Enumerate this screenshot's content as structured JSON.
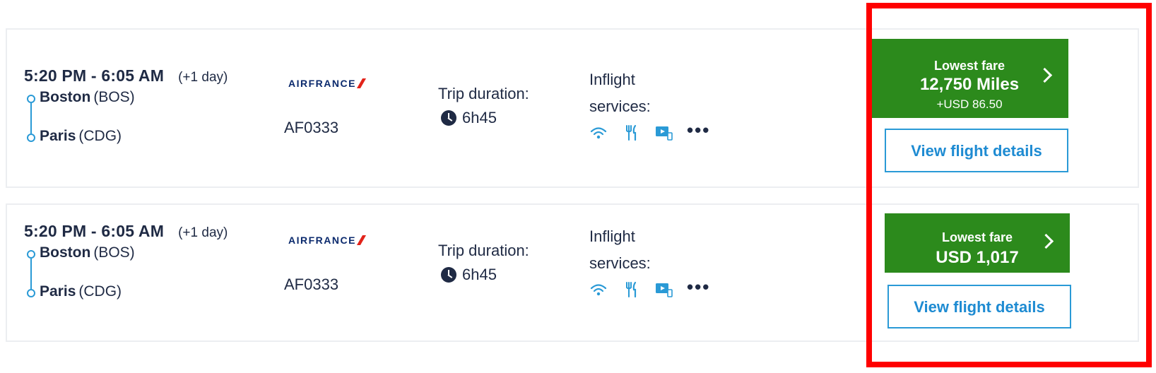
{
  "flights": [
    {
      "time": "5:20 PM - 6:05 AM",
      "plus_day": "(+1 day)",
      "origin_city": "Boston",
      "origin_code": "(BOS)",
      "dest_city": "Paris",
      "dest_code": "(CDG)",
      "airline_logo_text": "AIRFRANCE",
      "flight_number": "AF0333",
      "duration_label": "Trip duration:",
      "duration": "6h45",
      "services_label_line1": "Inflight",
      "services_label_line2": "services:",
      "services_icons": [
        "wifi-icon",
        "meal-icon",
        "entertainment-icon",
        "more-icon"
      ],
      "more": "•••",
      "fare_label": "Lowest fare",
      "fare_amount": "12,750 Miles",
      "fare_extra": "+USD 86.50",
      "details_label": "View flight details"
    },
    {
      "time": "5:20 PM - 6:05 AM",
      "plus_day": "(+1 day)",
      "origin_city": "Boston",
      "origin_code": "(BOS)",
      "dest_city": "Paris",
      "dest_code": "(CDG)",
      "airline_logo_text": "AIRFRANCE",
      "flight_number": "AF0333",
      "duration_label": "Trip duration:",
      "duration": "6h45",
      "services_label_line1": "Inflight",
      "services_label_line2": "services:",
      "services_icons": [
        "wifi-icon",
        "meal-icon",
        "entertainment-icon",
        "more-icon"
      ],
      "more": "•••",
      "fare_label": "Lowest fare",
      "fare_amount": "USD 1,017",
      "details_label": "View flight details"
    }
  ],
  "colors": {
    "fare_green": "#2c8a1c",
    "link_blue": "#1e8bd2",
    "route_blue": "#2a9ad6",
    "text_navy": "#1f2a44",
    "highlight_red": "#ff0000",
    "airline_red": "#e2231a",
    "airline_navy": "#0b2a6d"
  }
}
